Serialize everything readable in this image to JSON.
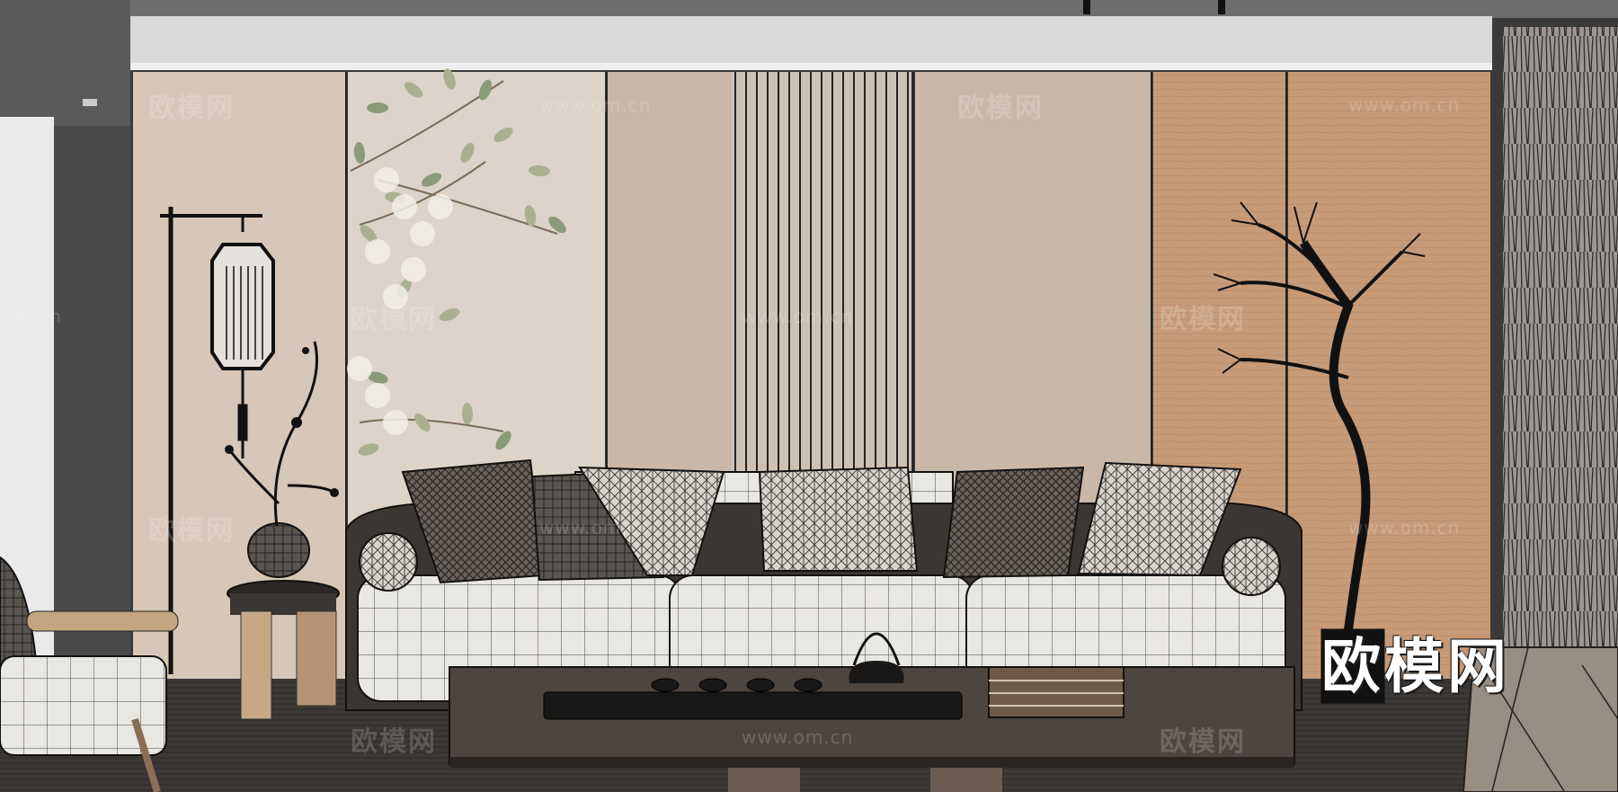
{
  "watermarks": {
    "brand_cn": "欧模网",
    "site_url": "www.om.cn",
    "site_url_short": "om.cn"
  },
  "logo": {
    "text": "欧模网"
  },
  "colors": {
    "ceiling": "#d9d9d9",
    "wall_beige": "#d6c7b8",
    "wall_taupe": "#c9b8a8",
    "wood_panel": "#c89b78",
    "floor": "#3b3835",
    "sofa": "#e9e7e2",
    "table": "#4d4540"
  }
}
